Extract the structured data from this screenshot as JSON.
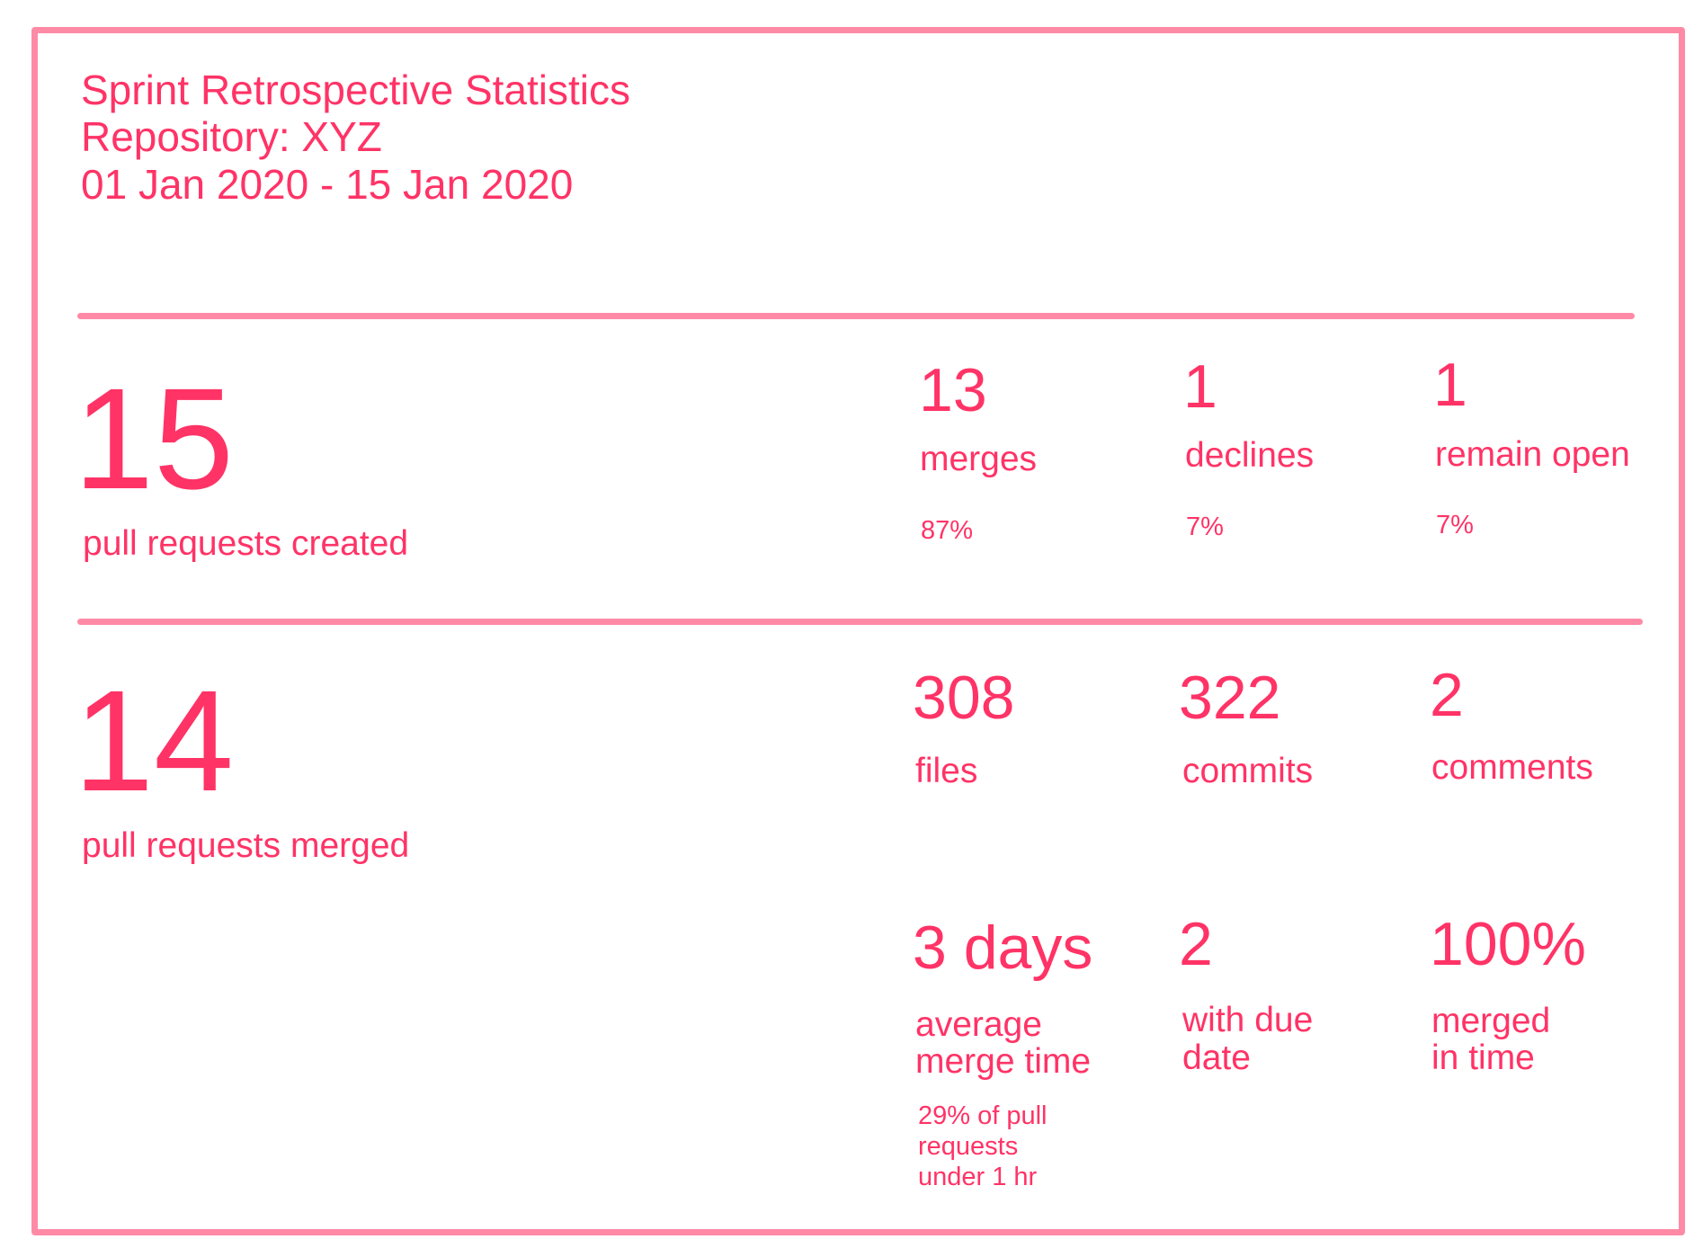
{
  "header": {
    "title": "Sprint Retrospective Statistics",
    "repository": "Repository: XYZ",
    "date_range": "01 Jan 2020 - 15 Jan 2020"
  },
  "created_section": {
    "total": "15",
    "total_label": "pull requests created",
    "stats": [
      {
        "value": "13",
        "label": "merges",
        "percent": "87%"
      },
      {
        "value": "1",
        "label": "declines",
        "percent": "7%"
      },
      {
        "value": "1",
        "label": "remain open",
        "percent": "7%"
      }
    ]
  },
  "merged_section": {
    "total": "14",
    "total_label": "pull requests merged",
    "stats": [
      {
        "value": "308",
        "label": "files"
      },
      {
        "value": "322",
        "label": "commits"
      },
      {
        "value": "2",
        "label": "comments"
      }
    ],
    "secondary_stats": [
      {
        "value": "3 days",
        "label_line1": "average",
        "label_line2": "merge time",
        "note_line1": "29% of pull",
        "note_line2": "requests",
        "note_line3": "under 1 hr"
      },
      {
        "value": "2",
        "label_line1": "with due",
        "label_line2": "date"
      },
      {
        "value": "100%",
        "label_line1": "merged",
        "label_line2": "in time"
      }
    ]
  },
  "colors": {
    "text": "#ff3366",
    "border": "#ff8aa6"
  }
}
